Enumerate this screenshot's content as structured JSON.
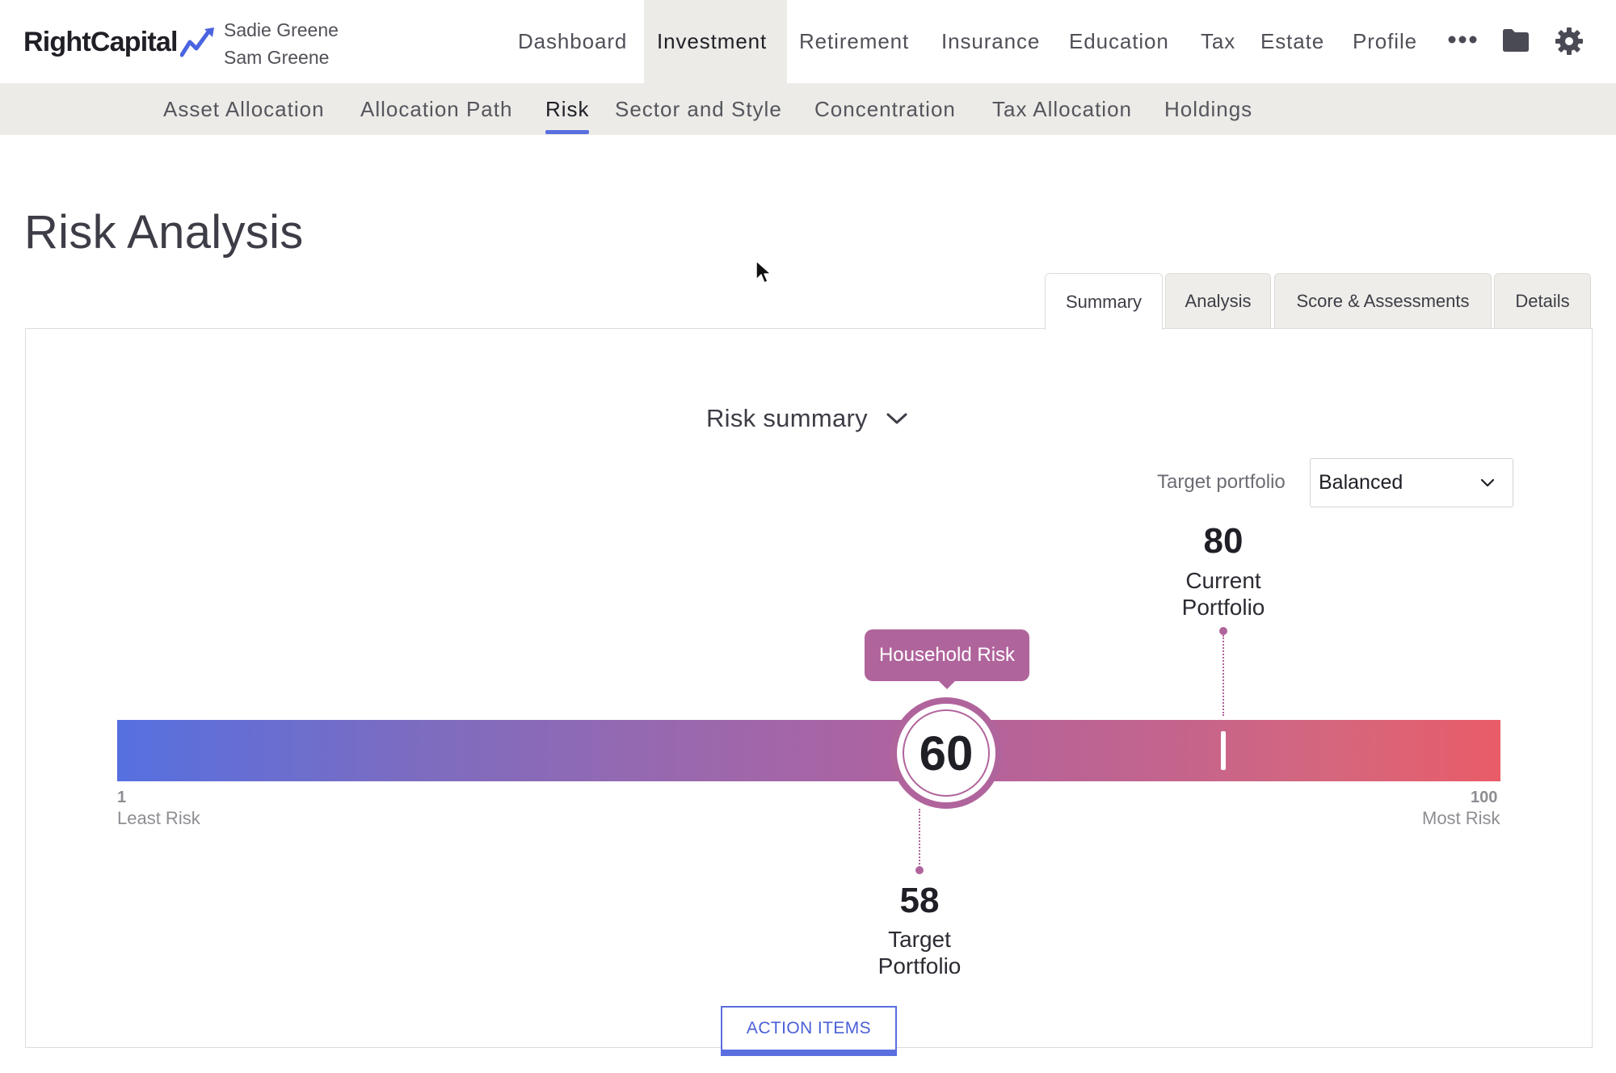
{
  "app": {
    "logo_text": "RightCapital",
    "clients": [
      "Sadie Greene",
      "Sam Greene"
    ]
  },
  "main_nav": [
    {
      "label": "Dashboard",
      "active": false
    },
    {
      "label": "Investment",
      "active": true
    },
    {
      "label": "Retirement",
      "active": false
    },
    {
      "label": "Insurance",
      "active": false
    },
    {
      "label": "Education",
      "active": false
    },
    {
      "label": "Tax",
      "active": false
    },
    {
      "label": "Estate",
      "active": false
    },
    {
      "label": "Profile",
      "active": false
    }
  ],
  "header_icons": [
    "more-dots-icon",
    "folder-icon",
    "gear-icon"
  ],
  "sub_nav": [
    {
      "label": "Asset Allocation",
      "active": false
    },
    {
      "label": "Allocation Path",
      "active": false
    },
    {
      "label": "Risk",
      "active": true
    },
    {
      "label": "Sector and Style",
      "active": false
    },
    {
      "label": "Concentration",
      "active": false
    },
    {
      "label": "Tax Allocation",
      "active": false
    },
    {
      "label": "Holdings",
      "active": false
    }
  ],
  "page": {
    "title": "Risk Analysis",
    "tabs": [
      {
        "label": "Summary",
        "active": true
      },
      {
        "label": "Analysis",
        "active": false
      },
      {
        "label": "Score & Assessments",
        "active": false
      },
      {
        "label": "Details",
        "active": false
      }
    ]
  },
  "summary": {
    "title": "Risk summary",
    "target_portfolio_label": "Target portfolio",
    "target_portfolio_value": "Balanced"
  },
  "risk_scale": {
    "min": "1",
    "min_label": "Least Risk",
    "max": "100",
    "max_label": "Most Risk",
    "household": {
      "label": "Household Risk",
      "value": 60
    },
    "current": {
      "value": 80,
      "line1": "Current",
      "line2": "Portfolio"
    },
    "target": {
      "value": 58,
      "line1": "Target",
      "line2": "Portfolio"
    }
  },
  "colors": {
    "accent": "#5a6ee0",
    "marker": "#b0649c",
    "scale_low": "#5670e0",
    "scale_high": "#e95c68"
  },
  "actions": {
    "action_items_label": "ACTION ITEMS"
  }
}
